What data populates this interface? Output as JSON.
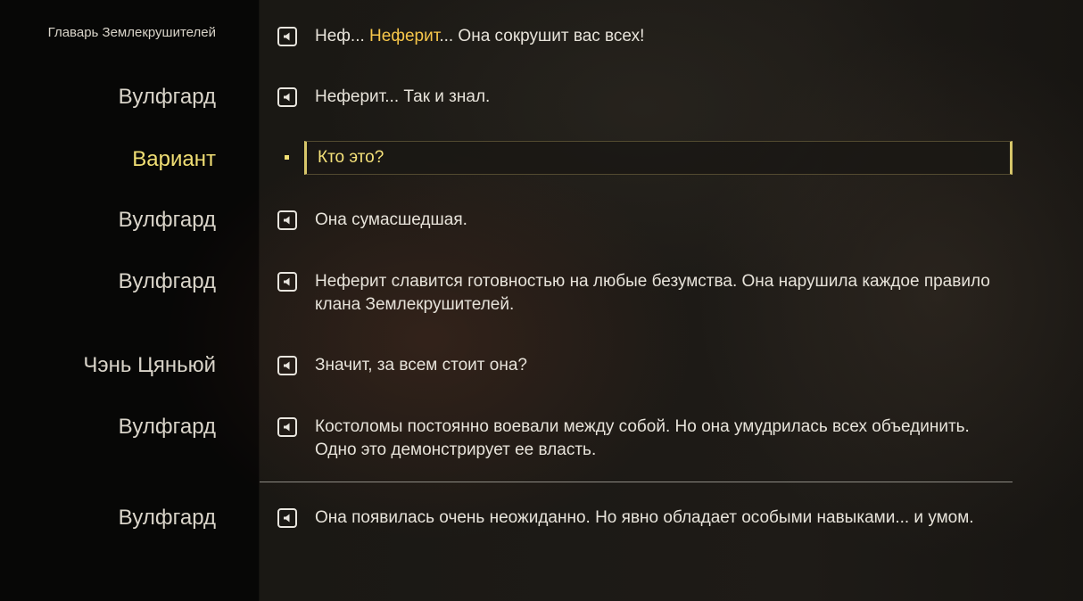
{
  "dialogue": [
    {
      "speaker": "Главарь Землекрушителей",
      "text_before": "Неф... ",
      "highlight": "Неферит",
      "text_after": "... Она сокрушит вас всех!"
    },
    {
      "speaker": "Вулфгард",
      "text": "Неферит... Так и знал."
    },
    {
      "speaker": "Вариант",
      "text": "Кто это?"
    },
    {
      "speaker": "Вулфгард",
      "text": "Она сумасшедшая."
    },
    {
      "speaker": "Вулфгард",
      "text": "Неферит славится готовностью на любые безумства. Она нарушила каждое правило клана Землекрушителей."
    },
    {
      "speaker": "Чэнь Цяньюй",
      "text": "Значит, за всем стоит она?"
    },
    {
      "speaker": "Вулфгард",
      "text": "Костоломы постоянно воевали между собой. Но она умудрилась всех объединить. Одно это демонстрирует ее власть."
    },
    {
      "speaker": "Вулфгард",
      "text": "Она появилась очень неожиданно. Но явно обладает особыми навыками... и умом."
    }
  ],
  "colors": {
    "speaker": "#d9d4c9",
    "option": "#f1df74",
    "highlight": "#f6c64a",
    "text": "#e7e3da"
  },
  "icons": {
    "voice": "speaker-icon"
  }
}
